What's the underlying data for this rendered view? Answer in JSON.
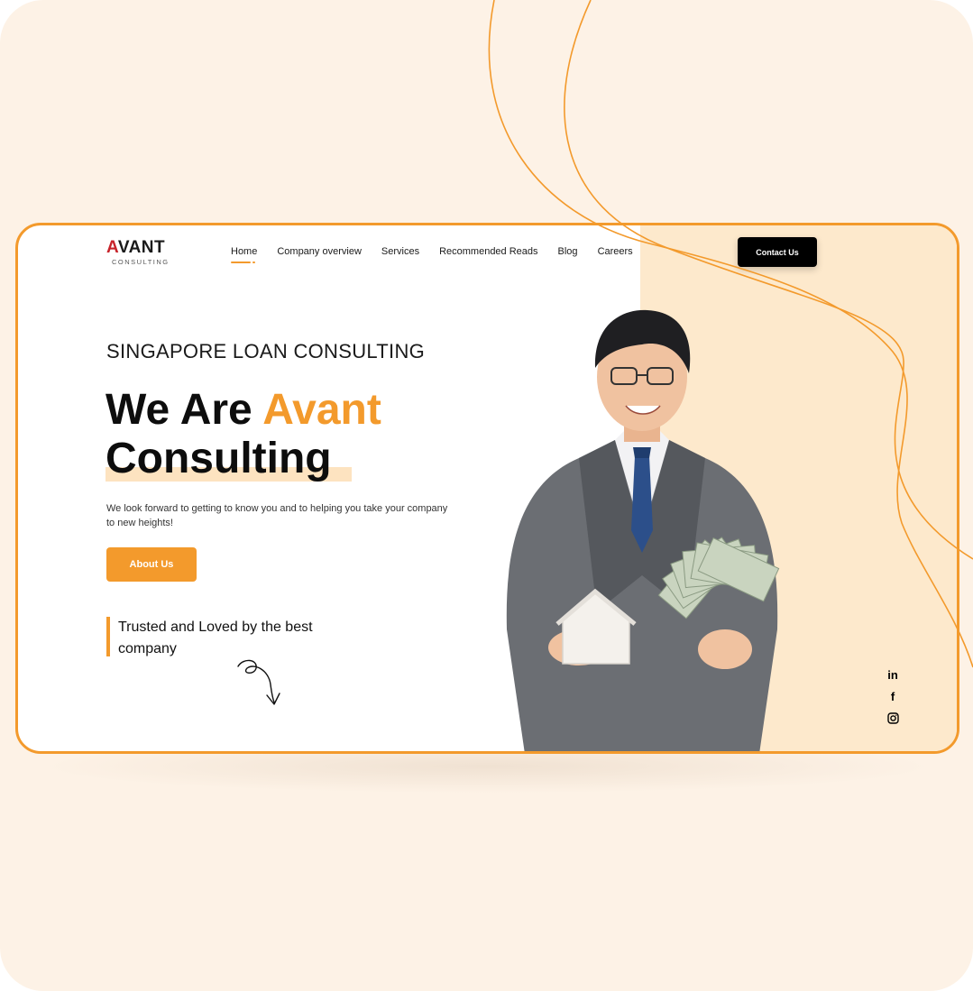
{
  "brand": {
    "logo_mark_a": "A",
    "logo_mark_rest": "VANT",
    "logo_sub": "CONSULTING"
  },
  "nav": {
    "items": [
      {
        "label": "Home",
        "active": true
      },
      {
        "label": "Company overview",
        "active": false
      },
      {
        "label": "Services",
        "active": false
      },
      {
        "label": "Recommended Reads",
        "active": false
      },
      {
        "label": "Blog",
        "active": false
      },
      {
        "label": "Careers",
        "active": false
      }
    ],
    "contact_label": "Contact Us"
  },
  "hero": {
    "eyebrow": "SINGAPORE LOAN CONSULTING",
    "headline_part1": "We Are ",
    "headline_accent": "Avant",
    "headline_line2": "Consulting",
    "intro": "We look forward to getting to know you and to helping you take your company to new heights!",
    "about_label": "About Us",
    "trusted_text": "Trusted and Loved by the best company"
  },
  "social": {
    "icons": [
      "linkedin-icon",
      "facebook-icon",
      "instagram-icon"
    ],
    "linkedin_glyph": "in",
    "facebook_glyph": "f"
  },
  "colors": {
    "accent": "#f39a2c",
    "page_bg": "#fdf2e6",
    "peach_panel": "#fde9cc",
    "dark": "#000000"
  }
}
